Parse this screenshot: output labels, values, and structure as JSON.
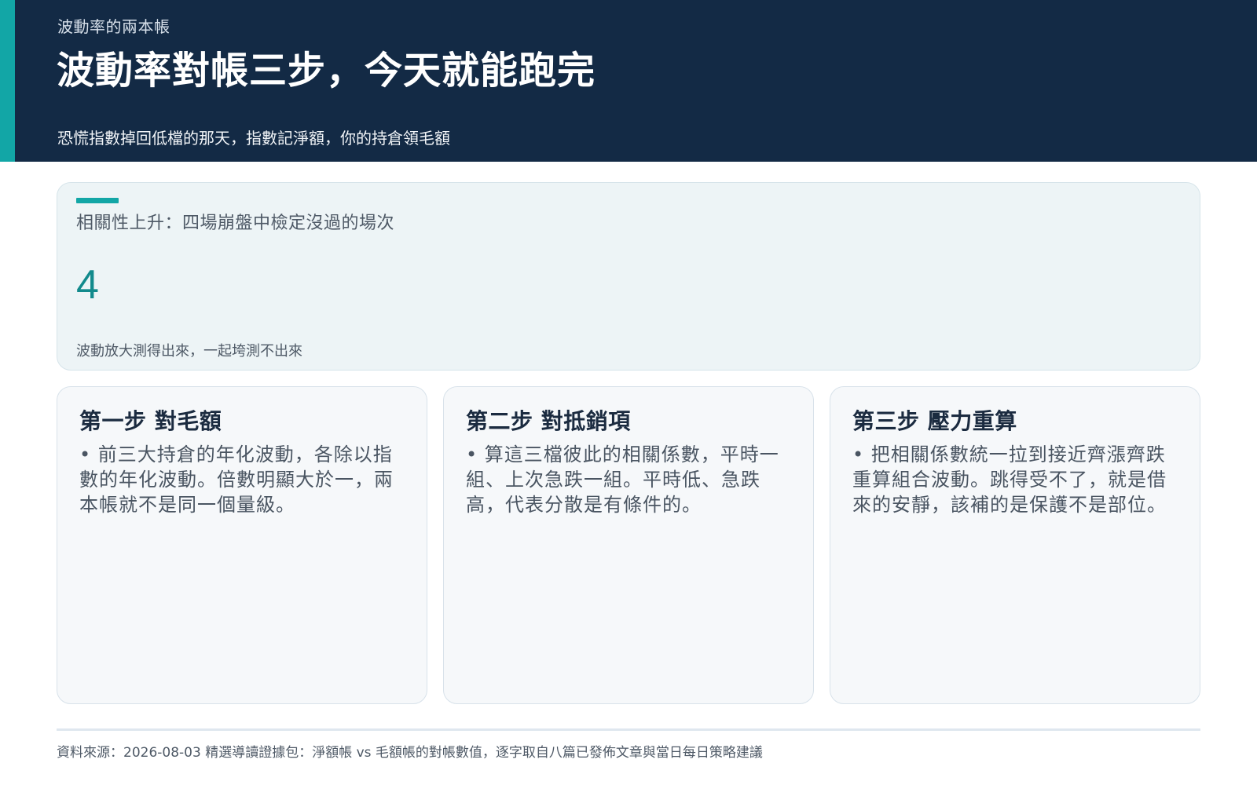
{
  "header": {
    "eyebrow": "波動率的兩本帳",
    "title": "波動率對帳三步，今天就能跑完",
    "subtitle": "恐慌指數掉回低檔的那天，指數記淨額，你的持倉領毛額"
  },
  "metric": {
    "label": "相關性上升：四場崩盤中檢定沒過的場次",
    "value": "4",
    "note": "波動放大測得出來，一起垮測不出來"
  },
  "steps": [
    {
      "title": "第一步 對毛額",
      "bullet": "•",
      "body": "前三大持倉的年化波動，各除以指數的年化波動。倍數明顯大於一，兩本帳就不是同一個量級。"
    },
    {
      "title": "第二步 對抵銷項",
      "bullet": "•",
      "body": "算這三檔彼此的相關係數，平時一組、上次急跌一組。平時低、急跌高，代表分散是有條件的。"
    },
    {
      "title": "第三步 壓力重算",
      "bullet": "•",
      "body": "把相關係數統一拉到接近齊漲齊跌重算組合波動。跳得受不了，就是借來的安靜，該補的是保護不是部位。"
    }
  ],
  "footer": {
    "source": "資料來源：2026-08-03 精選導讀證據包：淨額帳 vs 毛額帳的對帳數值，逐字取自八篇已發佈文章與當日每日策略建議"
  },
  "colors": {
    "header_bg": "#132a45",
    "accent": "#12a6a6",
    "metric_value": "#128a8c"
  }
}
